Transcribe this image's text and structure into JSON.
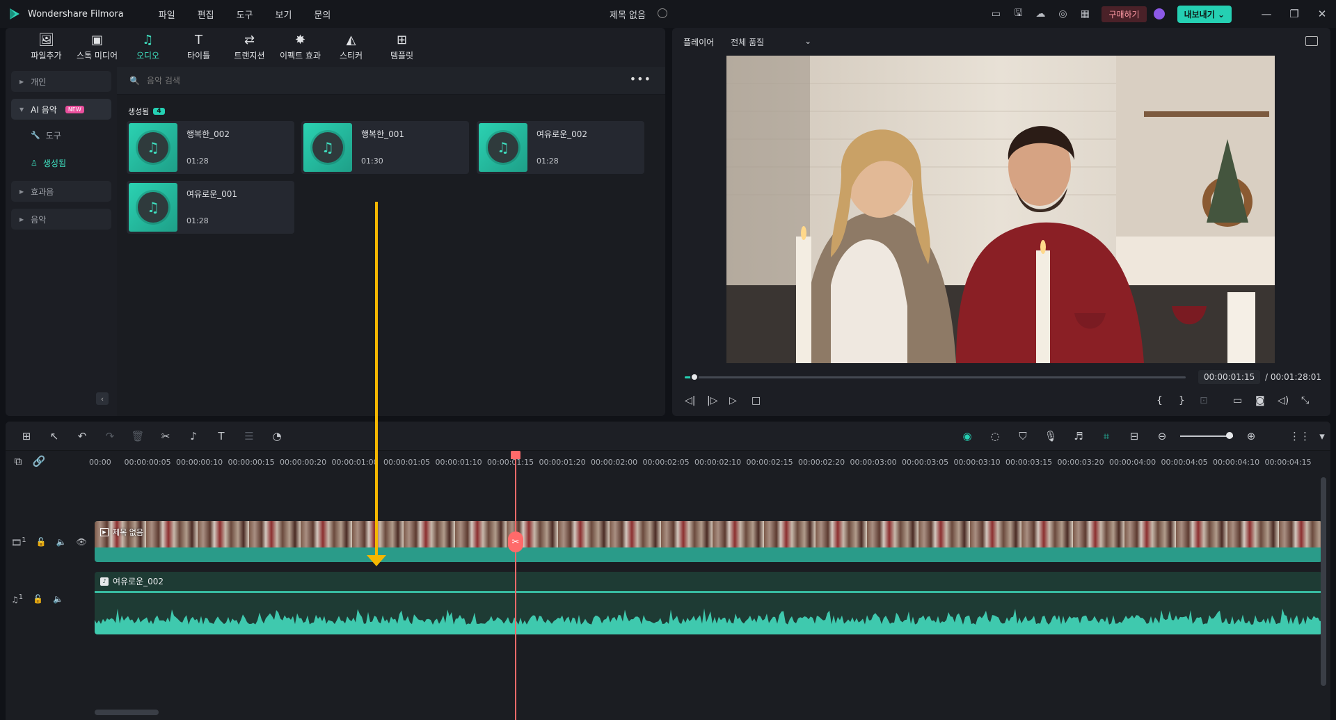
{
  "titlebar": {
    "app_name": "Wondershare Filmora",
    "menu": [
      "파일",
      "편집",
      "도구",
      "보기",
      "문의"
    ],
    "project_title": "제목 없음",
    "buy_label": "구매하기",
    "export_label": "내보내기"
  },
  "media_tabs": [
    {
      "label": "파일추가",
      "icon": "import-icon"
    },
    {
      "label": "스톡 미디어",
      "icon": "stock-media-icon"
    },
    {
      "label": "오디오",
      "icon": "music-note-icon"
    },
    {
      "label": "타이틀",
      "icon": "title-icon"
    },
    {
      "label": "트랜지션",
      "icon": "transition-icon"
    },
    {
      "label": "이펙트 효과",
      "icon": "effects-icon"
    },
    {
      "label": "스티커",
      "icon": "sticker-icon"
    },
    {
      "label": "템플릿",
      "icon": "template-icon"
    }
  ],
  "sidebar": {
    "personal": "개인",
    "ai_music": "AI 음악",
    "new_badge": "NEW",
    "tools": "도구",
    "generated": "생성됨",
    "sound_effects": "효과음",
    "music": "음악"
  },
  "search": {
    "placeholder": "음악 검색"
  },
  "generated_section": {
    "label": "생성됨",
    "count": "4"
  },
  "audio_items": [
    {
      "name": "행복한_002",
      "duration": "01:28"
    },
    {
      "name": "행복한_001",
      "duration": "01:30"
    },
    {
      "name": "여유로운_002",
      "duration": "01:28"
    },
    {
      "name": "여유로운_001",
      "duration": "01:28"
    }
  ],
  "player": {
    "label": "플레이어",
    "quality": "전체 품질",
    "current_time": "00:00:01:15",
    "total_time": "/ 00:01:28:01",
    "progress": 0.015
  },
  "timeline": {
    "ruler": [
      "00:00",
      "00:00:00:05",
      "00:00:00:10",
      "00:00:00:15",
      "00:00:00:20",
      "00:00:01:00",
      "00:00:01:05",
      "00:00:01:10",
      "00:00:01:15",
      "00:00:01:20",
      "00:00:02:00",
      "00:00:02:05",
      "00:00:02:10",
      "00:00:02:15",
      "00:00:02:20",
      "00:00:03:00",
      "00:00:03:05",
      "00:00:03:10",
      "00:00:03:15",
      "00:00:03:20",
      "00:00:04:00",
      "00:00:04:05",
      "00:00:04:10",
      "00:00:04:15"
    ],
    "video_clip_label": "제목 없음",
    "video_track_num": "1",
    "audio_track_num": "1",
    "audio_clip_label": "여유로운_002"
  },
  "colors": {
    "accent": "#25d0b3",
    "playhead": "#ff6a6a",
    "annotation": "#f5b700",
    "buy": "#ff9aa5"
  }
}
